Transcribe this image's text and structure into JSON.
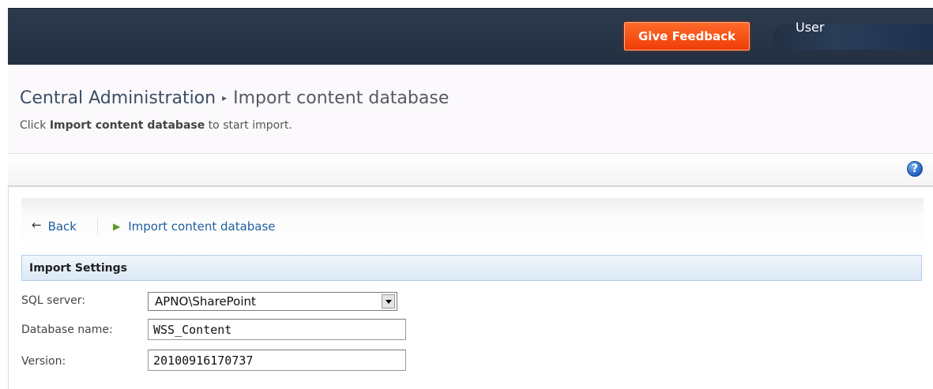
{
  "header": {
    "feedback_label": "Give Feedback",
    "user_label": "User"
  },
  "breadcrumb": {
    "root": "Central Administration",
    "separator": "▸",
    "current": "Import content database"
  },
  "subtitle": {
    "prefix": "Click ",
    "bold": "Import content database",
    "suffix": " to start import."
  },
  "help_icon": {
    "icon": "help-icon",
    "glyph": "?"
  },
  "toolbar": {
    "back_icon": "←",
    "back_label": "Back",
    "import_icon": "▶",
    "import_label": "Import content database"
  },
  "section": {
    "title": "Import Settings"
  },
  "fields": {
    "sql_server": {
      "label": "SQL server:",
      "value": "APNO\\SharePoint"
    },
    "database_name": {
      "label": "Database name:",
      "value": "WSS_Content"
    },
    "version": {
      "label": "Version:",
      "value": "20100916170737"
    }
  },
  "colors": {
    "topbar": "#223042",
    "feedback": "#ee3d07",
    "link": "#1f5f9e",
    "section_header": "#dbe8f7"
  }
}
